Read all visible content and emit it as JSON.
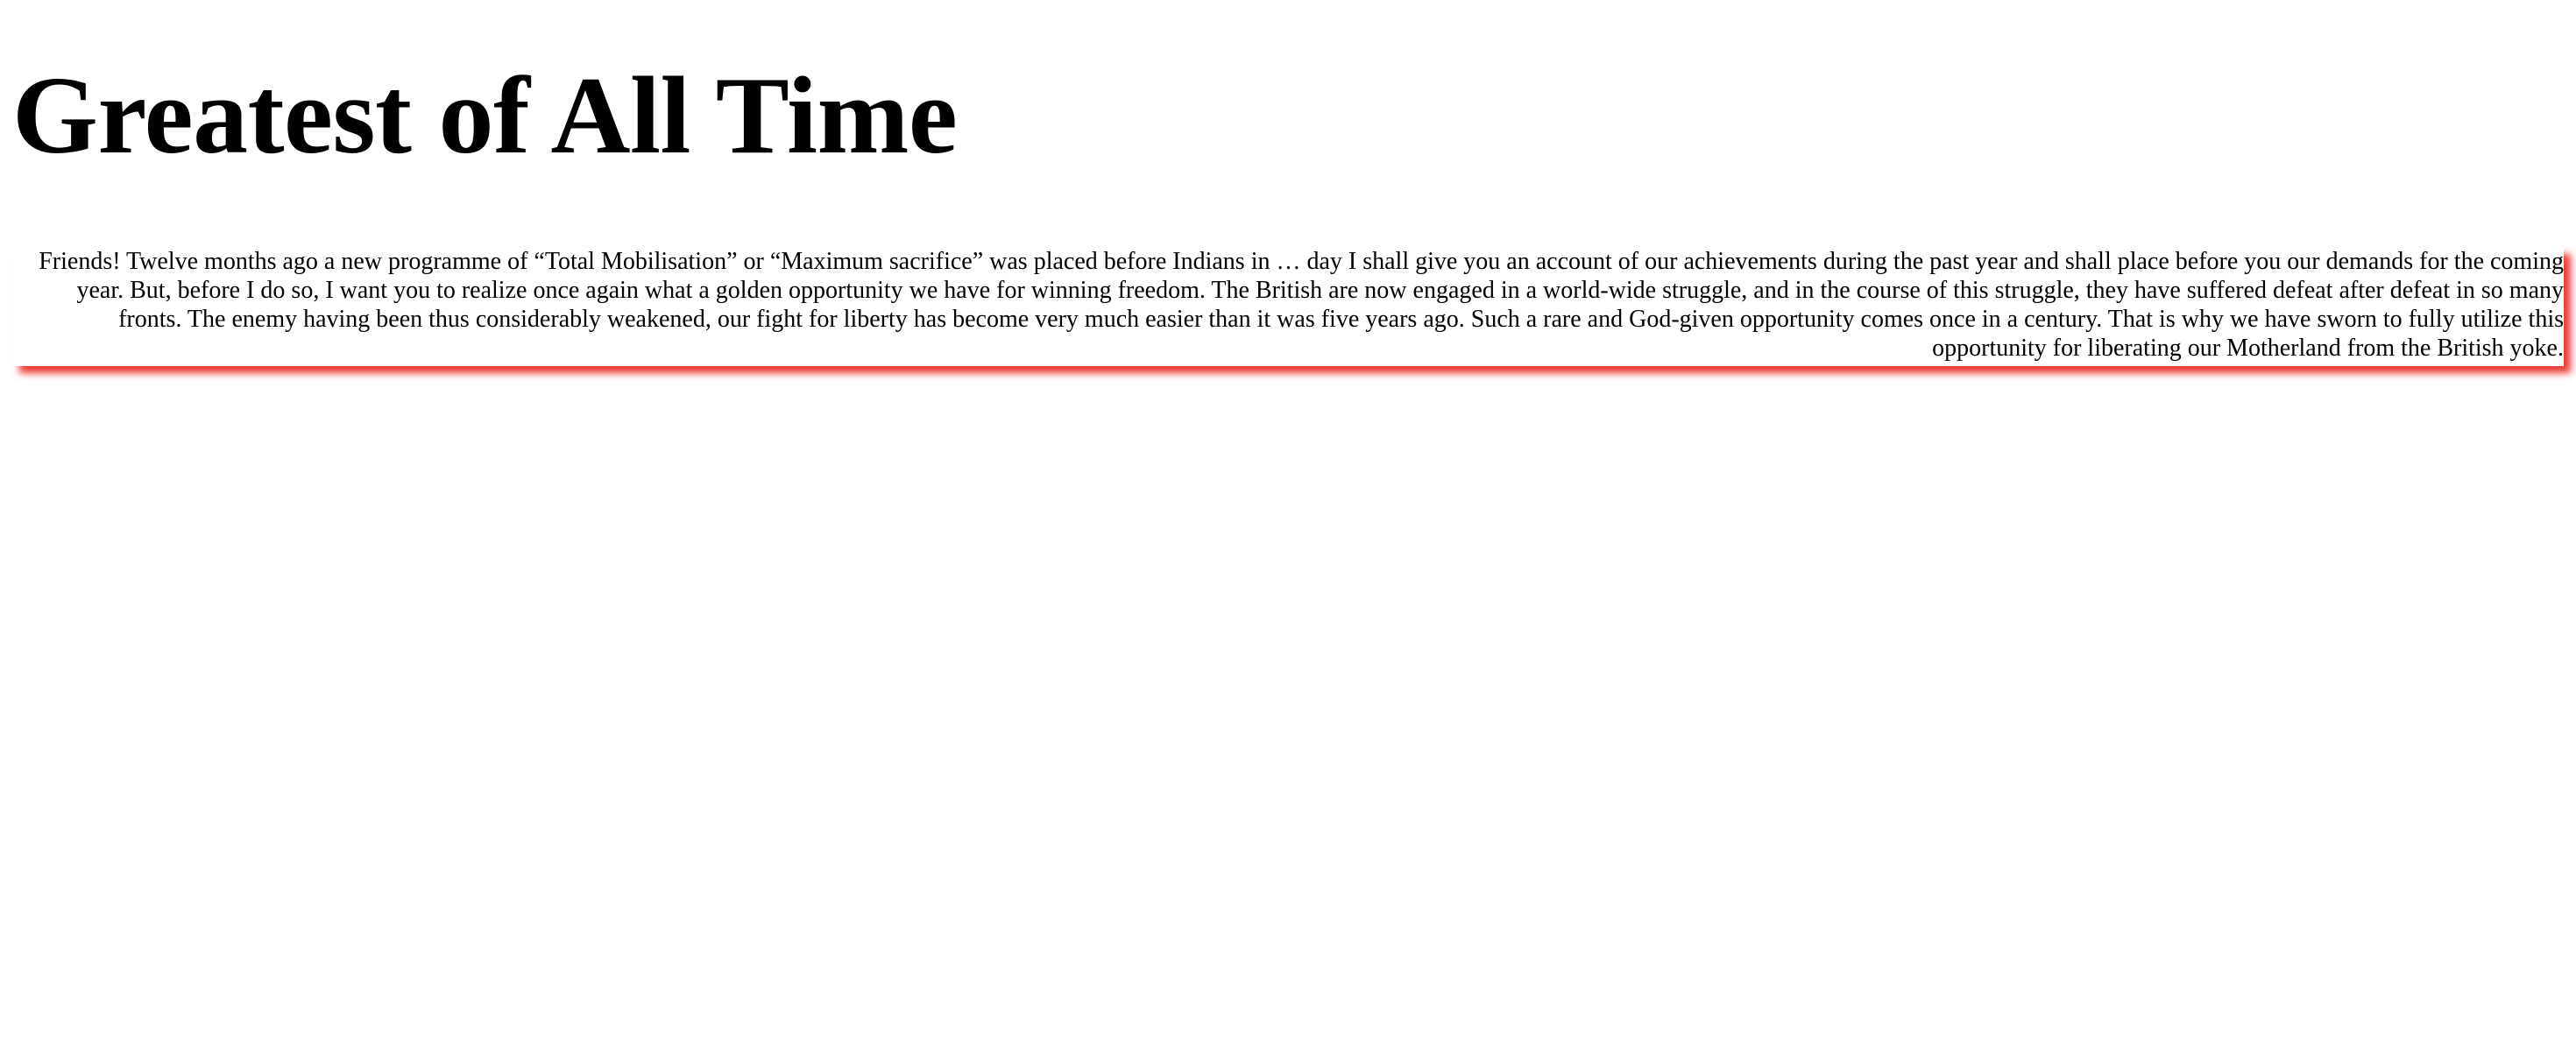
{
  "article": {
    "title": "Greatest of All Time",
    "quote": "Friends! Twelve months ago a new programme of “Total Mobilisation” or “Maximum sacrifice” was placed before Indians in … day I shall give you an account of our achievements during the past year and shall place before you our demands for the coming year. But, before I do so, I want you to realize once again what a golden opportunity we have for winning freedom. The British are now engaged in a world-wide struggle, and in the course of this struggle, they have suffered defeat after defeat in so many fronts. The enemy having been thus considerably weakened, our fight for liberty has become very much easier than it was five years ago. Such a rare and God-given opportunity comes once in a century. That is why we have sworn to fully utilize this opportunity for liberating our Motherland from the British yoke."
  },
  "colors": {
    "text": "#000000",
    "background": "#ffffff",
    "shadow_accent": "#ee3a32"
  }
}
